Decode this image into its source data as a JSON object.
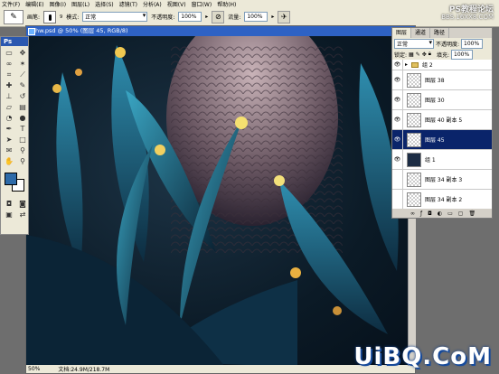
{
  "menu": [
    "文件(F)",
    "编辑(E)",
    "图像(I)",
    "图层(L)",
    "选择(S)",
    "滤镜(T)",
    "分析(A)",
    "视图(V)",
    "窗口(W)",
    "帮助(H)"
  ],
  "options": {
    "brush_label": "画笔:",
    "brush_size": "9",
    "mode_label": "模式:",
    "mode_value": "正常",
    "opacity_label": "不透明度:",
    "opacity_value": "100%",
    "flow_label": "流量:",
    "flow_value": "100%"
  },
  "logo_tr": {
    "line1": "PS教程论坛",
    "line2": "BBS.16XX8.COM"
  },
  "toolbox": {
    "title": "Ps"
  },
  "document": {
    "title": "hw.psd @ 50% (图层 45, RGB/8)",
    "zoom": "50%",
    "doc_size": "文档:24.9M/218.7M"
  },
  "colors": {
    "foreground": "#2d6aa8",
    "background": "#ffffff"
  },
  "layers_panel": {
    "tabs": [
      "图层",
      "通道",
      "路径"
    ],
    "blend_mode": "正常",
    "opacity_label": "不透明度:",
    "opacity_value": "100%",
    "lock_label": "锁定:",
    "fill_label": "填充:",
    "fill_value": "100%",
    "items": [
      {
        "name": "组 2",
        "type": "group",
        "visible": true,
        "selected": false
      },
      {
        "name": "图层 38",
        "type": "layer",
        "visible": true,
        "selected": false
      },
      {
        "name": "图层 30",
        "type": "layer",
        "visible": true,
        "selected": false
      },
      {
        "name": "图层 40 副本 5",
        "type": "layer",
        "visible": true,
        "selected": false
      },
      {
        "name": "图层 45",
        "type": "layer",
        "visible": true,
        "selected": true
      },
      {
        "name": "组 1",
        "type": "layer-dark",
        "visible": true,
        "selected": false
      },
      {
        "name": "图层 34 副本 3",
        "type": "layer",
        "visible": false,
        "selected": false
      },
      {
        "name": "图层 34 副本 2",
        "type": "layer",
        "visible": false,
        "selected": false
      }
    ]
  },
  "watermark": "UiBQ.CoM"
}
